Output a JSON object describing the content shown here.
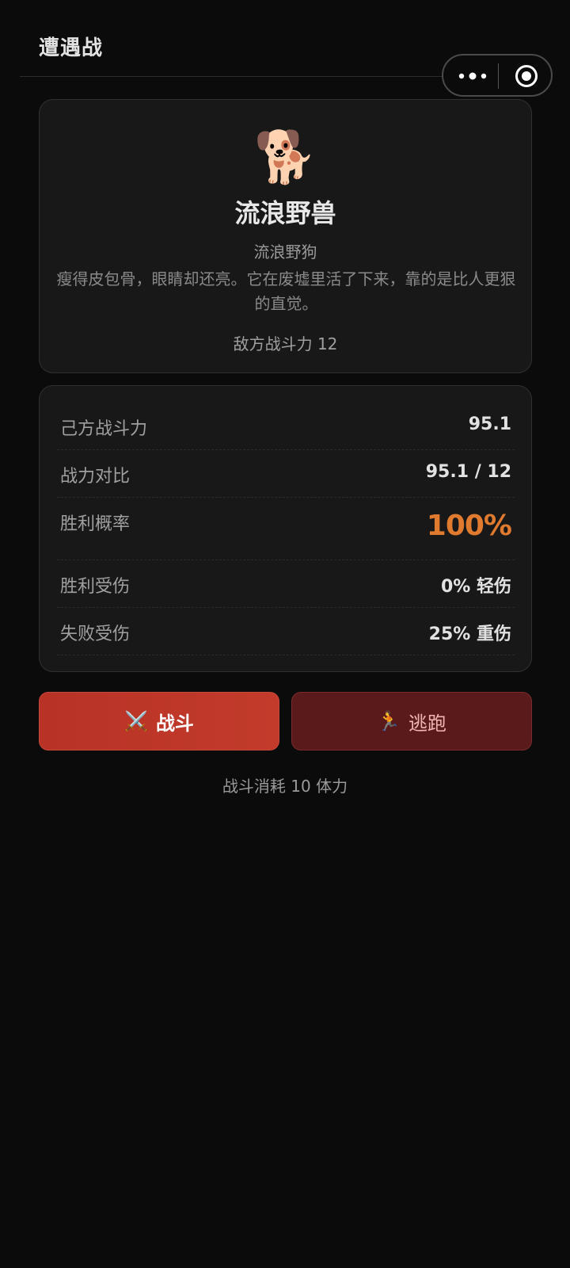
{
  "header": {
    "title": "遭遇战"
  },
  "enemy": {
    "icon": "🐕",
    "name": "流浪野兽",
    "subtitle": "流浪野狗",
    "description": "瘦得皮包骨，眼睛却还亮。它在废墟里活了下来，靠的是比人更狠的直觉。",
    "power_text": "敌方战斗力 12"
  },
  "stats": [
    {
      "label": "己方战斗力",
      "value": "95.1"
    },
    {
      "label": "战力对比",
      "value": "95.1 / 12"
    },
    {
      "label": "胜利概率",
      "value": "100%"
    },
    {
      "label": "胜利受伤",
      "value": "0% 轻伤"
    },
    {
      "label": "失败受伤",
      "value": "25% 重伤"
    }
  ],
  "actions": {
    "fight_icon": "⚔️",
    "fight_label": "战斗",
    "flee_icon": "🏃",
    "flee_label": "逃跑"
  },
  "footnote": "战斗消耗 10 体力",
  "colors": {
    "background": "#0b0b0b",
    "card": "#181818",
    "accent_orange": "#e07a2e",
    "fight_button": "#c23b2b",
    "flee_button": "#5a1a1c"
  }
}
